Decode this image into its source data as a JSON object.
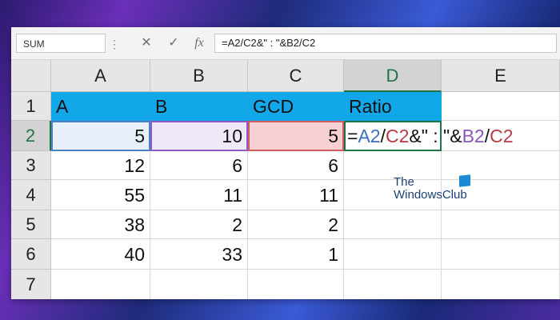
{
  "formula_bar": {
    "name_box": "SUM",
    "name_box_dots": "⋮",
    "cancel_icon": "✕",
    "enter_icon": "✓",
    "fx_label": "fx",
    "formula": "=A2/C2&\" : \"&B2/C2"
  },
  "columns": [
    "A",
    "B",
    "C",
    "D",
    "E"
  ],
  "rows": [
    "1",
    "2",
    "3",
    "4",
    "5",
    "6",
    "7"
  ],
  "header_row": [
    "A",
    "B",
    "GCD",
    "Ratio"
  ],
  "data_rows": [
    [
      "5",
      "10",
      "5"
    ],
    [
      "12",
      "6",
      "6"
    ],
    [
      "55",
      "11",
      "11"
    ],
    [
      "38",
      "2",
      "2"
    ],
    [
      "40",
      "33",
      "1"
    ]
  ],
  "active_cell": {
    "ref": "D2",
    "parts": [
      "=",
      "A2",
      "/",
      "C2",
      "&\" : \"&",
      "B2",
      "/",
      "C2"
    ]
  },
  "watermark": {
    "line1": "The",
    "line2": "WindowsClub"
  },
  "colors": {
    "header_fill": "#12a7e8",
    "selection": "#217346",
    "ref_a": "#4f7fc4",
    "ref_b": "#8e5bc4",
    "ref_c": "#d05a62"
  }
}
